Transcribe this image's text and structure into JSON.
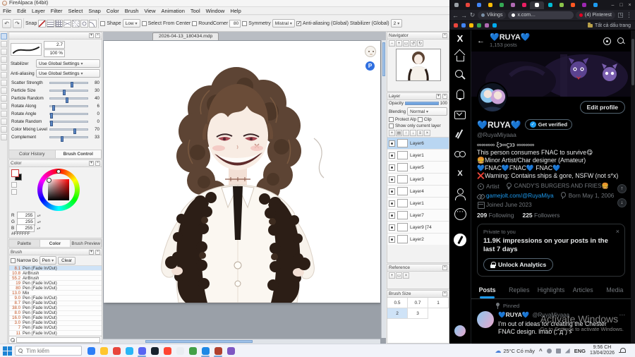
{
  "firealpaca": {
    "window_title": "FireAlpaca (64bit)",
    "menu": [
      "File",
      "Edit",
      "Layer",
      "Filter",
      "Select",
      "Snap",
      "Color",
      "Brush",
      "View",
      "Animation",
      "Tool",
      "Window",
      "Help"
    ],
    "toolbar": {
      "snap_label": "Snap",
      "snap_modes": [
        "snap-off-icon",
        "snap-parallel-icon",
        "snap-cross-icon",
        "snap-vanishing-icon",
        "snap-radial-icon",
        "snap-circle-icon",
        "snap-curve-icon"
      ],
      "shape_label": "Shape",
      "quality_value": "Low",
      "select_from_center_label": "Select From Center",
      "roundcorner_label": "RoundCorner",
      "roundcorner_value": "80",
      "symmetry_label": "Symmetry",
      "material_value": "Mistral",
      "antialiasing_label": "Anti-aliasing (Global)",
      "stabilizer_label": "Stabilizer (Global)",
      "stabilizer_value": "2"
    },
    "tools": [
      {
        "name": "brush-tool-icon",
        "sel": true
      },
      {
        "name": "eraser-tool-icon",
        "sel": false
      },
      {
        "name": "pen-tool-icon",
        "sel": false
      },
      {
        "name": "airbrush-tool-icon",
        "sel": false
      },
      {
        "name": "fill-tool-icon",
        "sel": false
      },
      {
        "name": "gradient-tool-icon",
        "sel": false
      },
      {
        "name": "select-tool-icon",
        "sel": false
      },
      {
        "name": "lasso-tool-icon",
        "sel": false
      },
      {
        "name": "magic-wand-tool-icon",
        "sel": false
      },
      {
        "name": "move-tool-icon",
        "sel": false
      },
      {
        "name": "text-tool-icon",
        "sel": false
      },
      {
        "name": "eyedropper-tool-icon",
        "sel": false
      },
      {
        "name": "hand-tool-icon",
        "sel": false
      },
      {
        "name": "zoom-tool-icon",
        "sel": false
      }
    ],
    "brush_control": {
      "size_value": "2.7",
      "opacity_value": "100 %",
      "stabilizer_label": "Stabilizer",
      "stabilizer_value": "Use Global Settings",
      "antialiasing_label": "Anti-aliasing",
      "antialiasing_value": "Use Global Settings",
      "sliders": [
        {
          "label": "Scatter Strength",
          "value": "80",
          "pos": "58%"
        },
        {
          "label": "Particle Size",
          "value": "30",
          "pos": "38%"
        },
        {
          "label": "Particle Random",
          "value": "40",
          "pos": "45%"
        },
        {
          "label": "Rotate Along",
          "value": "6",
          "pos": "10%"
        },
        {
          "label": "Rotate Angle",
          "value": "0",
          "pos": "4%"
        },
        {
          "label": "Rotate Random",
          "value": "0",
          "pos": "4%"
        },
        {
          "label": "Color Mixing Level",
          "value": "70",
          "pos": "66%"
        },
        {
          "label": "Complement",
          "value": "33",
          "pos": "33%"
        }
      ],
      "tabs": [
        {
          "label": "Color History",
          "active": false
        },
        {
          "label": "Brush Control",
          "active": true
        }
      ]
    },
    "color_panel": {
      "title": "Color",
      "channels": [
        {
          "label": "R",
          "value": "255"
        },
        {
          "label": "G",
          "value": "255"
        },
        {
          "label": "B",
          "value": "255"
        }
      ],
      "hex_value": "#FFFFFF"
    },
    "panel_tabs": [
      {
        "label": "Palette",
        "active": false
      },
      {
        "label": "Color",
        "active": true
      },
      {
        "label": "Brush Preview",
        "active": false
      }
    ],
    "brush_panel": {
      "title": "Brush",
      "narrow_label": "Narrow Do",
      "filter_value": "Pen",
      "clear_label": "Clear",
      "brushes": [
        {
          "size": "8.1",
          "name": "Pen (Fade In/Out)",
          "selected": true
        },
        {
          "size": "10.8",
          "name": "AirBrush",
          "selected": false
        },
        {
          "size": "55.2",
          "name": "AirBrush",
          "selected": false
        },
        {
          "size": "19",
          "name": "Pen (Fade In/Out)",
          "selected": false
        },
        {
          "size": "80",
          "name": "Pen (Fade In/Out)",
          "selected": false
        },
        {
          "size": "13.0",
          "name": "Mix",
          "selected": false
        },
        {
          "size": "9.0",
          "name": "Pen (Fade In/Out)",
          "selected": false
        },
        {
          "size": "8.7",
          "name": "Pen (Fade In/Out)",
          "selected": false
        },
        {
          "size": "38.0",
          "name": "Pen (Fade In/Out)",
          "selected": false
        },
        {
          "size": "8.0",
          "name": "Pen (Fade In/Out)",
          "selected": false
        },
        {
          "size": "16.0",
          "name": "Pen (Fade In/Out)",
          "selected": false
        },
        {
          "size": "3.0",
          "name": "Pen (Fade In/Out)",
          "selected": false
        },
        {
          "size": "7",
          "name": "Pen (Fade In/Out)",
          "selected": false
        },
        {
          "size": "11",
          "name": "Pen (Fade In/Out)",
          "selected": false
        }
      ]
    },
    "canvas": {
      "document_tab": "2026-04-13_180434.mdp",
      "sticker_p": "P"
    },
    "navigator": {
      "title": "Navigator"
    },
    "layer_panel": {
      "title": "Layer",
      "opacity_label": "Opacity",
      "opacity_value": "100",
      "blending_label": "Blending",
      "blending_value": "Normal",
      "protect_alpha_label": "Protect Alp",
      "clipping_label": "Clip",
      "show_only_label": "Show only current layer",
      "layers": [
        {
          "name": "Layer6",
          "selected": true
        },
        {
          "name": "Layer1",
          "selected": false
        },
        {
          "name": "Layer5",
          "selected": false
        },
        {
          "name": "Layer3",
          "selected": false
        },
        {
          "name": "Layer4",
          "selected": false
        },
        {
          "name": "Layer1",
          "selected": false
        },
        {
          "name": "Layer7",
          "selected": false
        },
        {
          "name": "Layer9 [74",
          "selected": false
        },
        {
          "name": "Layer2",
          "selected": false
        }
      ]
    },
    "reference_panel": {
      "title": "Reference"
    },
    "brush_size_panel": {
      "title": "Brush Size",
      "sizes": [
        {
          "v": "0.5",
          "selected": false
        },
        {
          "v": "0.7",
          "selected": false
        },
        {
          "v": "1",
          "selected": false
        },
        {
          "v": "2",
          "selected": true
        },
        {
          "v": "3",
          "selected": false
        }
      ]
    }
  },
  "browser": {
    "tabs": [
      {
        "color": "#9aa0a6",
        "active": false
      },
      {
        "color": "#e8453c",
        "active": false
      },
      {
        "color": "#4285f4",
        "active": false
      },
      {
        "color": "#fbbc05",
        "active": false
      },
      {
        "color": "#34a853",
        "active": false
      },
      {
        "color": "#b06ab3",
        "active": false
      },
      {
        "color": "#e91e63",
        "active": false
      },
      {
        "color": "#ffffff",
        "active": true
      },
      {
        "color": "#00bcd4",
        "active": false
      },
      {
        "color": "#8bc34a",
        "active": false
      },
      {
        "color": "#ff5722",
        "active": false
      },
      {
        "color": "#9c27b0",
        "active": false
      },
      {
        "color": "#1d9bf0",
        "active": false
      }
    ],
    "nav_pills": [
      {
        "label": "Vikings",
        "color": "#7a8fa6",
        "addr": false
      },
      {
        "label": "x.com…",
        "color": "#ffffff",
        "addr": true
      },
      {
        "label": "(4) Pinterest",
        "color": "#e60023",
        "addr": false
      }
    ],
    "bookmark_colors": [
      "#e8453c",
      "#4285f4",
      "#fbbc05",
      "#34a853",
      "#b06ab3",
      "#00acee"
    ],
    "bookmarks_label": "Tất cả dấu trang",
    "rail_icons": [
      "home-icon",
      "search-icon",
      "notifications-icon",
      "messages-icon",
      "grok-icon",
      "communities-icon",
      "premium-icon",
      "profile-icon",
      "more-icon"
    ],
    "twitter": {
      "header_title": "💙RUYA💙",
      "header_subtitle": "1,153 posts",
      "display_name": "💙RUYA💙",
      "handle": "@RuyaMiyaaa",
      "edit_profile_label": "Edit profile",
      "get_verified_label": "Get verified",
      "bio_lines": [
        "∞∞∞∞ ξ϶∞ϛ϶϶ ∞∞∞∞",
        "This person consumes FNAC to survive😋",
        "🍔Minor Artist/Char designer (Amateur)",
        "💙FNAC💙FNAC💙 FNAC💙",
        "❌Warning: Contains ships & gore, NSFW (not s*x)"
      ],
      "meta": [
        {
          "icon": "category-icon",
          "text": "Artist",
          "link": false
        },
        {
          "icon": "location-icon",
          "text": "CANDY'S BURGERS AND FRIES🍔",
          "link": false
        },
        {
          "icon": "link-icon",
          "text": "gamejolt.com/@RuyaMiya",
          "link": true
        },
        {
          "icon": "balloon-icon",
          "text": "Born May 1, 2006",
          "link": false
        },
        {
          "icon": "calendar-icon",
          "text": "Joined June 2023",
          "link": false
        }
      ],
      "following_count": "209",
      "following_label": "Following",
      "followers_count": "225",
      "followers_label": "Followers",
      "analytics_private": "Private to you",
      "analytics_headline": "11.9K impressions on your posts in the last 7 days",
      "analytics_button": "Unlock Analytics",
      "tabs": [
        {
          "label": "Posts",
          "active": true
        },
        {
          "label": "Replies",
          "active": false
        },
        {
          "label": "Highlights",
          "active": false
        },
        {
          "label": "Articles",
          "active": false
        },
        {
          "label": "Media",
          "active": false
        }
      ],
      "pinned_label": "Pinned",
      "pinned_author": "💙RUYA💙",
      "pinned_handle": "@RuyaMiyaaa",
      "pinned_text": "I'm out of ideas for creating the Chester FNAC design. lmao (;´д`)ゞ"
    },
    "watermark": {
      "line1": "Activate Windows",
      "line2": "Go to Settings to activate Windows."
    }
  },
  "taskbar": {
    "search_placeholder": "Tìm kiếm",
    "weather_text": "25°C Có mây",
    "language": "ENG",
    "time": "9:56 CH",
    "date": "13/04/2026",
    "apps": [
      {
        "color": "#2d7ff7",
        "active": false
      },
      {
        "color": "#ffc62e",
        "active": false
      },
      {
        "color": "#e8453c",
        "active": false
      },
      {
        "color": "#29b6f6",
        "active": false
      },
      {
        "color": "#5865f2",
        "active": true
      },
      {
        "color": "#16222e",
        "active": false
      },
      {
        "color": "#ff4432",
        "active": false
      },
      {
        "color": "#e9edf2",
        "active": false
      },
      {
        "color": "#43a047",
        "active": false
      },
      {
        "color": "#1e88e5",
        "active": true
      },
      {
        "color": "#b0402e",
        "active": true
      },
      {
        "color": "#7e57c2",
        "active": false
      }
    ]
  }
}
